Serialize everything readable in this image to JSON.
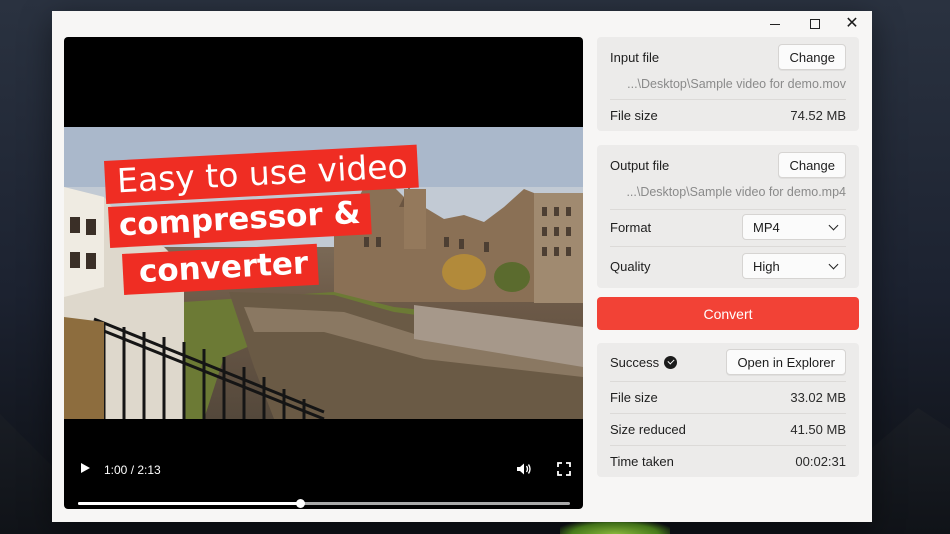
{
  "window": {
    "controls": {
      "minimize": "minimize",
      "maximize": "maximize",
      "close": "close"
    }
  },
  "player": {
    "overlay_lines": [
      "Easy to use video",
      "compressor &",
      "converter"
    ],
    "time_display": "1:00 / 2:13",
    "progress_fraction": 0.452,
    "icons": {
      "play": "play-icon",
      "volume": "volume-icon",
      "fullscreen": "fullscreen-icon"
    }
  },
  "input": {
    "label": "Input file",
    "change_label": "Change",
    "path": "...\\Desktop\\Sample video for demo.mov",
    "size_label": "File size",
    "size_value": "74.52 MB"
  },
  "output": {
    "label": "Output file",
    "change_label": "Change",
    "path": "...\\Desktop\\Sample video for demo.mp4",
    "format_label": "Format",
    "format_value": "MP4",
    "quality_label": "Quality",
    "quality_value": "High"
  },
  "convert_label": "Convert",
  "result": {
    "status": "Success",
    "open_label": "Open in Explorer",
    "size_label": "File size",
    "size_value": "33.02 MB",
    "reduced_label": "Size reduced",
    "reduced_value": "41.50 MB",
    "time_label": "Time taken",
    "time_value": "00:02:31"
  },
  "colors": {
    "accent": "#f24236",
    "banner": "#ef2d23",
    "panel": "#ecebea",
    "window": "#f7f6f5"
  }
}
